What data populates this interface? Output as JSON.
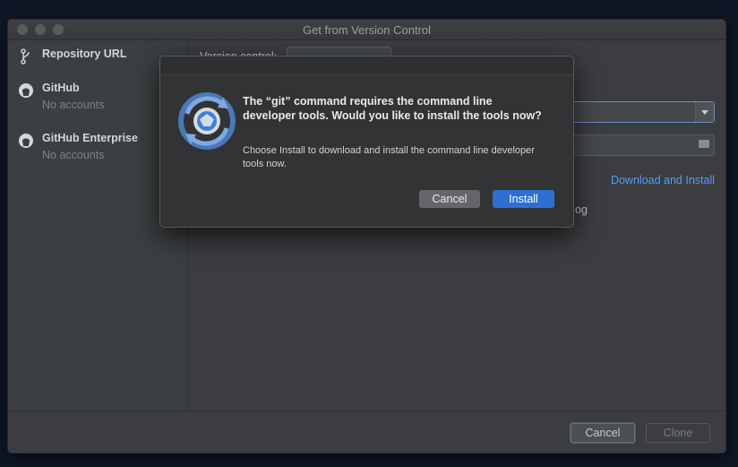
{
  "window": {
    "title": "Get from Version Control"
  },
  "sidebar": {
    "items": [
      {
        "label": "Repository URL",
        "sub": ""
      },
      {
        "label": "GitHub",
        "sub": "No accounts"
      },
      {
        "label": "GitHub Enterprise",
        "sub": "No accounts"
      }
    ]
  },
  "main": {
    "version_control_label": "Version control:",
    "download_link": "Download and Install",
    "fragment_text": "og"
  },
  "footer": {
    "cancel_label": "Cancel",
    "clone_label": "Clone"
  },
  "dialog": {
    "title": "The “git” command requires the command line developer tools. Would you like to install the tools now?",
    "body": "Choose Install to download and install the command line developer tools now.",
    "cancel_label": "Cancel",
    "install_label": "Install",
    "icon": "software-update-icon"
  },
  "colors": {
    "accent": "#2e6fd1",
    "link": "#589df6",
    "window_bg": "#3b3d40"
  }
}
